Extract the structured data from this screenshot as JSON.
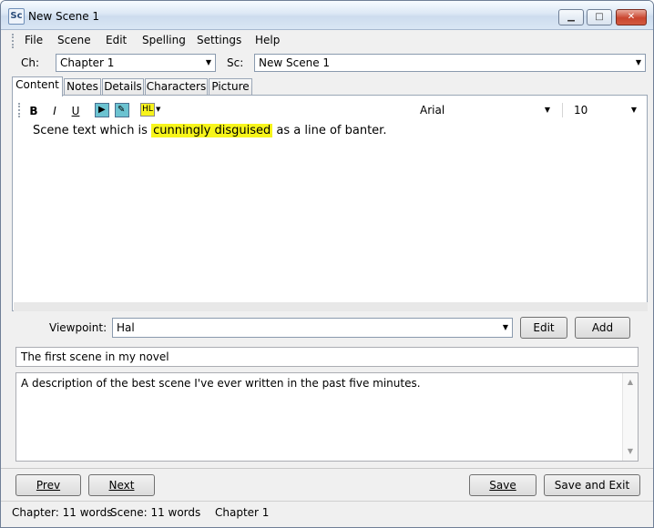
{
  "window": {
    "title": "New Scene 1",
    "app_icon_text": "Sc",
    "minimize": "▁",
    "maximize": "□",
    "close": "✕"
  },
  "menu": {
    "items": [
      "File",
      "Scene",
      "Edit",
      "Spelling",
      "Settings",
      "Help"
    ]
  },
  "chapter": {
    "label": "Ch:",
    "value": "Chapter 1"
  },
  "scene": {
    "label": "Sc:",
    "value": "New Scene 1"
  },
  "tabs": [
    "Content",
    "Notes",
    "Details",
    "Characters",
    "Picture"
  ],
  "toolbar": {
    "bold": "B",
    "italic": "I",
    "underline": "U",
    "highlight_label": "HL",
    "font": "Arial",
    "size": "10"
  },
  "editor": {
    "before": "Scene text which is ",
    "highlighted": "cunningly disguised",
    "after": " as a line of banter."
  },
  "viewpoint": {
    "label": "Viewpoint:",
    "value": "Hal",
    "edit_label": "Edit",
    "add_label": "Add"
  },
  "summary": "The first scene in my novel",
  "description": "A description of the best scene I've ever written in the past five minutes.",
  "buttons": {
    "prev": "Prev",
    "next": "Next",
    "save": "Save",
    "save_exit": "Save and Exit"
  },
  "status": {
    "chapter_words": "Chapter: 11 words",
    "scene_words": "Scene: 11 words",
    "chapter_name": "Chapter 1"
  },
  "colors": {
    "highlight": "#f7f51b",
    "toolbar_toggle": "#6cc3d1"
  }
}
